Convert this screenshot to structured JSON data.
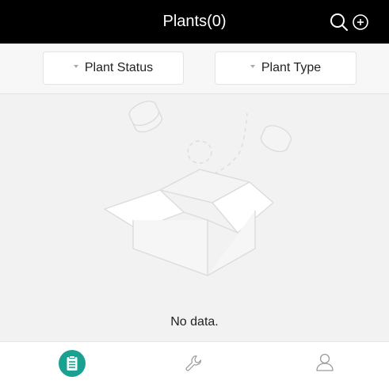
{
  "header": {
    "title": "Plants(0)",
    "icons": [
      "search-icon",
      "add-circle-icon"
    ]
  },
  "filters": [
    {
      "label": "Plant Status"
    },
    {
      "label": "Plant Type"
    }
  ],
  "empty_state": {
    "message": "No data.",
    "illustration": "empty-box-icon"
  },
  "tabbar": {
    "items": [
      {
        "icon": "clipboard-icon",
        "active": true
      },
      {
        "icon": "wrench-icon",
        "active": false
      },
      {
        "icon": "user-icon",
        "active": false
      }
    ]
  },
  "colors": {
    "header_bg": "#000000",
    "accent": "#1aa192",
    "background": "#f2f2f2"
  }
}
